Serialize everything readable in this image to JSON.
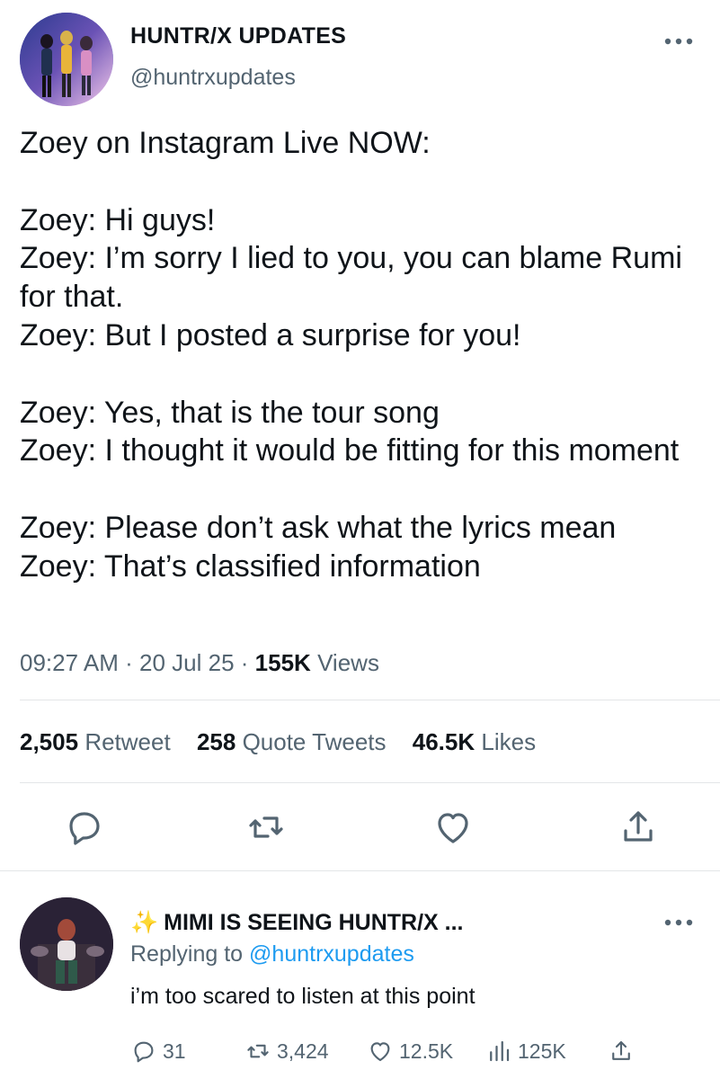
{
  "tweet": {
    "display_name": "HUNTR/X UPDATES",
    "handle": "@huntrxupdates",
    "body": "Zoey on Instagram Live NOW:\n\nZoey: Hi guys!\nZoey: I’m sorry I lied to you, you can blame Rumi for that.\nZoey: But I posted a surprise for you!\n\nZoey: Yes, that is the tour song\nZoey: I thought it would be fitting for this moment\n\nZoey: Please don’t ask what the lyrics mean\nZoey: That’s classified information",
    "time": "09:27 AM",
    "date": "20 Jul 25",
    "separator": "·",
    "views_count": "155K",
    "views_label": "Views",
    "retweets_count": "2,505",
    "retweets_label": "Retweet",
    "quotes_count": "258",
    "quotes_label": "Quote Tweets",
    "likes_count": "46.5K",
    "likes_label": "Likes"
  },
  "reply": {
    "sparkle": "✨",
    "display_name": "MIMI IS SEEING HUNTR/X ...",
    "replying_prefix": "Replying to",
    "replying_handle": "@huntrxupdates",
    "text": "i’m too scared to listen at this point",
    "replies": "31",
    "retweets": "3,424",
    "likes": "12.5K",
    "views": "125K"
  },
  "icons": {
    "more": "more-horizontal-icon",
    "reply": "reply-bubble-icon",
    "retweet": "retweet-icon",
    "like": "heart-icon",
    "share": "share-icon",
    "views": "views-bar-icon"
  },
  "colors": {
    "text": "#0f1419",
    "secondary": "#536471",
    "link": "#1d9bf0",
    "divider": "#e3e6e8"
  }
}
